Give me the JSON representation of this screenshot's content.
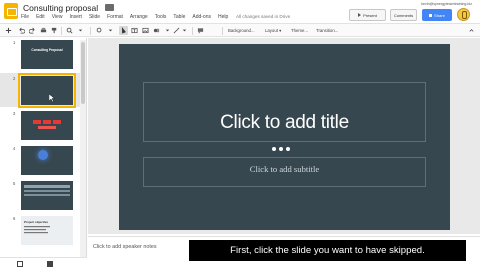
{
  "app": {
    "doc_title": "Consulting proposal",
    "user_email": "kevin@synergyteachtraining.biz",
    "present_label": "Present",
    "comments_label": "Comments",
    "share_label": "Share",
    "saved_status": "All changes saved in Drive"
  },
  "menu": [
    "File",
    "Edit",
    "View",
    "Insert",
    "Slide",
    "Format",
    "Arrange",
    "Tools",
    "Table",
    "Add-ons",
    "Help"
  ],
  "toolbar": {
    "background_label": "Background...",
    "layout_label": "Layout ▾",
    "theme_label": "Theme...",
    "transition_label": "Transition..."
  },
  "filmstrip": {
    "slides": [
      {
        "number": "1",
        "thumb_title": "Consulting Proposal",
        "thumb_sub": ""
      },
      {
        "number": "2",
        "thumb_title": "",
        "thumb_sub": ""
      },
      {
        "number": "3",
        "thumb_title": "",
        "thumb_sub": ""
      },
      {
        "number": "4",
        "thumb_title": "",
        "thumb_sub": ""
      },
      {
        "number": "5",
        "thumb_title": "",
        "thumb_sub": ""
      },
      {
        "number": "6",
        "thumb_title": "Project objective",
        "thumb_sub": ""
      }
    ]
  },
  "slide": {
    "title_placeholder": "Click to add title",
    "subtitle_placeholder": "Click to add subtitle"
  },
  "notes": {
    "placeholder": "Click to add speaker notes"
  },
  "caption": {
    "text": "First, click the slide you want to have skipped."
  },
  "colors": {
    "slide_bg": "#37474f",
    "share_blue": "#4285f4",
    "app_yellow": "#f5b400"
  }
}
